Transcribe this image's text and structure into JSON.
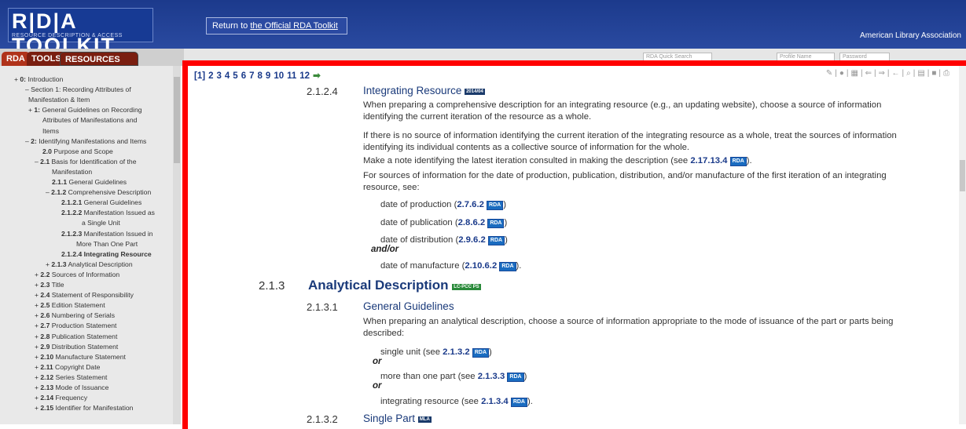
{
  "header": {
    "logo_main": "R|D|A TOOLKIT",
    "logo_sub": "RESOURCE DESCRIPTION & ACCESS",
    "return_prefix": "Return to ",
    "return_link": "the Official RDA Toolkit",
    "org": "American Library Association"
  },
  "tabs": {
    "rda": "RDA",
    "tools": "TOOLS",
    "resources": "RESOURCES"
  },
  "search": {
    "quick": "RDA Quick Search",
    "profile": "Profile Name",
    "password": "Password"
  },
  "sidebar": {
    "items": [
      {
        "pre": "+ ",
        "num": "0:",
        "label": " Introduction"
      },
      {
        "pre": "– ",
        "num": "",
        "label": "Section 1: Recording Attributes of"
      },
      {
        "pre": "",
        "num": "",
        "label": "Manifestation & Item"
      },
      {
        "pre": "+ ",
        "num": "1:",
        "label": " General Guidelines on Recording"
      },
      {
        "pre": "",
        "num": "",
        "label": "Attributes of Manifestations and"
      },
      {
        "pre": "",
        "num": "",
        "label": "Items"
      },
      {
        "pre": "– ",
        "num": "2:",
        "label": " Identifying Manifestations and Items"
      },
      {
        "pre": "",
        "num": "2.0",
        "label": " Purpose and Scope"
      },
      {
        "pre": "– ",
        "num": "2.1",
        "label": " Basis for Identification of the"
      },
      {
        "pre": "",
        "num": "",
        "label": "Manifestation"
      },
      {
        "pre": "",
        "num": "2.1.1",
        "label": " General Guidelines"
      },
      {
        "pre": "– ",
        "num": "2.1.2",
        "label": " Comprehensive Description"
      },
      {
        "pre": "",
        "num": "2.1.2.1",
        "label": " General Guidelines"
      },
      {
        "pre": "",
        "num": "2.1.2.2",
        "label": " Manifestation Issued as"
      },
      {
        "pre": "",
        "num": "",
        "label": "a Single Unit"
      },
      {
        "pre": "",
        "num": "2.1.2.3",
        "label": " Manifestation Issued in"
      },
      {
        "pre": "",
        "num": "",
        "label": "More Than One Part"
      },
      {
        "pre": "",
        "num": "2.1.2.4",
        "label": " Integrating Resource"
      },
      {
        "pre": "+ ",
        "num": "2.1.3",
        "label": " Analytical Description"
      },
      {
        "pre": "+ ",
        "num": "2.2",
        "label": " Sources of Information"
      },
      {
        "pre": "+ ",
        "num": "2.3",
        "label": " Title"
      },
      {
        "pre": "+ ",
        "num": "2.4",
        "label": " Statement of Responsibility"
      },
      {
        "pre": "+ ",
        "num": "2.5",
        "label": " Edition Statement"
      },
      {
        "pre": "+ ",
        "num": "2.6",
        "label": " Numbering of Serials"
      },
      {
        "pre": "+ ",
        "num": "2.7",
        "label": " Production Statement"
      },
      {
        "pre": "+ ",
        "num": "2.8",
        "label": " Publication Statement"
      },
      {
        "pre": "+ ",
        "num": "2.9",
        "label": " Distribution Statement"
      },
      {
        "pre": "+ ",
        "num": "2.10",
        "label": " Manufacture Statement"
      },
      {
        "pre": "+ ",
        "num": "2.11",
        "label": " Copyright Date"
      },
      {
        "pre": "+ ",
        "num": "2.12",
        "label": " Series Statement"
      },
      {
        "pre": "+ ",
        "num": "2.13",
        "label": " Mode of Issuance"
      },
      {
        "pre": "+ ",
        "num": "2.14",
        "label": " Frequency"
      },
      {
        "pre": "+ ",
        "num": "2.15",
        "label": " Identifier for Manifestation"
      }
    ]
  },
  "pagination": [
    "[1]",
    "2",
    "3",
    "4",
    "5",
    "6",
    "7",
    "8",
    "9",
    "10",
    "11",
    "12"
  ],
  "content": {
    "s1_num": "2.1.2.4",
    "s1_title": "Integrating Resource",
    "s1_badge": "2014/04",
    "p1": "When preparing a comprehensive description for an integrating resource (e.g., an updating website), choose a source of information identifying the current iteration of the resource as a whole.",
    "p2": "If there is no source of information identifying the current iteration of the integrating resource as a whole, treat the sources of information identifying its individual contents as a collective source of information for the whole.",
    "p3_text": "Make a note identifying the latest iteration consulted in making the description (see ",
    "p3_ref": "2.17.13.4",
    "p3_end": ").",
    "p4": "For sources of information for the date of production, publication, distribution, and/or manufacture of the first iteration of an integrating resource, see:",
    "d1_text": "date of production (",
    "d1_ref": "2.7.6.2",
    "d2_text": "date of publication (",
    "d2_ref": "2.8.6.2",
    "d3_text": "date of distribution (",
    "d3_ref": "2.9.6.2",
    "andor": "and/or",
    "d4_text": "date of manufacture (",
    "d4_ref": "2.10.6.2",
    "close": ")",
    "close_dot": ").",
    "rda": "RDA",
    "s2_num": "2.1.3",
    "s2_title": "Analytical Description",
    "s2_badge": "LC-PCC PS",
    "s3_num": "2.1.3.1",
    "s3_title": "General Guidelines",
    "p5": "When preparing an analytical description, choose a source of information appropriate to the mode of issuance of the part or parts being described:",
    "u1_text": "single unit (see ",
    "u1_ref": "2.1.3.2",
    "or": "or",
    "u2_text": "more than one part (see ",
    "u2_ref": "2.1.3.3",
    "u3_text": "integrating resource (see ",
    "u3_ref": "2.1.3.4",
    "s4_num": "2.1.3.2",
    "s4_title": "Single Part",
    "s4_badge": "MLA"
  }
}
